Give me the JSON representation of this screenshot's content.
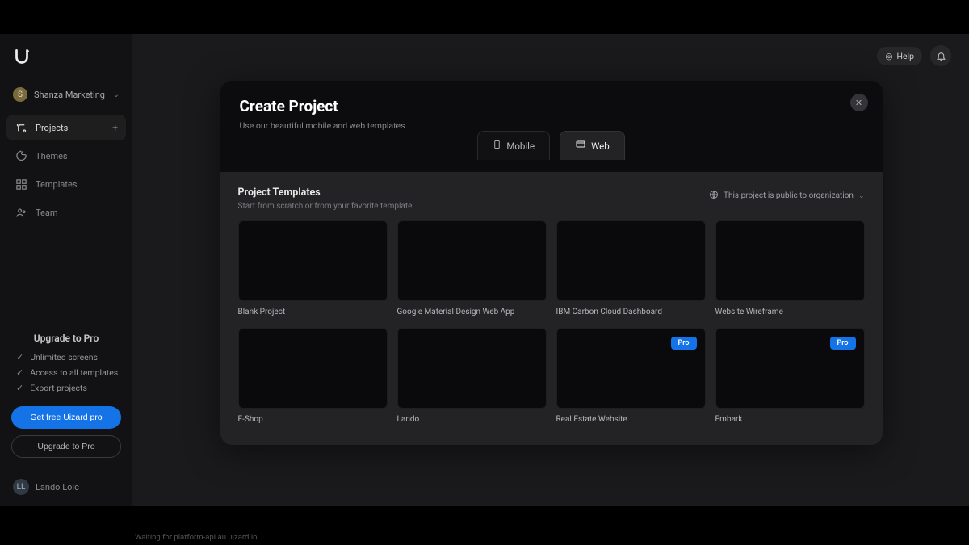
{
  "sidebar": {
    "workspace": {
      "initial": "S",
      "name": "Shanza Marketing"
    },
    "nav": [
      {
        "label": "Projects",
        "active": true,
        "hasPlus": true
      },
      {
        "label": "Themes"
      },
      {
        "label": "Templates"
      },
      {
        "label": "Team"
      }
    ],
    "upgrade": {
      "title": "Upgrade to Pro",
      "features": [
        "Unlimited screens",
        "Access to all templates",
        "Export projects"
      ],
      "cta_primary": "Get free Uizard pro",
      "cta_secondary": "Upgrade to Pro"
    },
    "user": {
      "initials": "LL",
      "name": "Lando Loïc"
    }
  },
  "topbar": {
    "help": "Help"
  },
  "modal": {
    "title": "Create Project",
    "subtitle": "Use our beautiful mobile and web templates",
    "tabs": {
      "mobile": "Mobile",
      "web": "Web"
    },
    "section": {
      "title": "Project Templates",
      "subtitle": "Start from scratch or from your favorite template"
    },
    "visibility": "This project is public to organization",
    "templates": [
      {
        "name": "Blank Project",
        "pro": false
      },
      {
        "name": "Google Material Design Web App",
        "pro": false
      },
      {
        "name": "IBM Carbon Cloud Dashboard",
        "pro": false
      },
      {
        "name": "Website Wireframe",
        "pro": false
      },
      {
        "name": "E-Shop",
        "pro": false
      },
      {
        "name": "Lando",
        "pro": false
      },
      {
        "name": "Real Estate Website",
        "pro": true
      },
      {
        "name": "Embark",
        "pro": true
      }
    ],
    "pro_label": "Pro"
  },
  "status": "Waiting for platform-api.au.uizard.io"
}
